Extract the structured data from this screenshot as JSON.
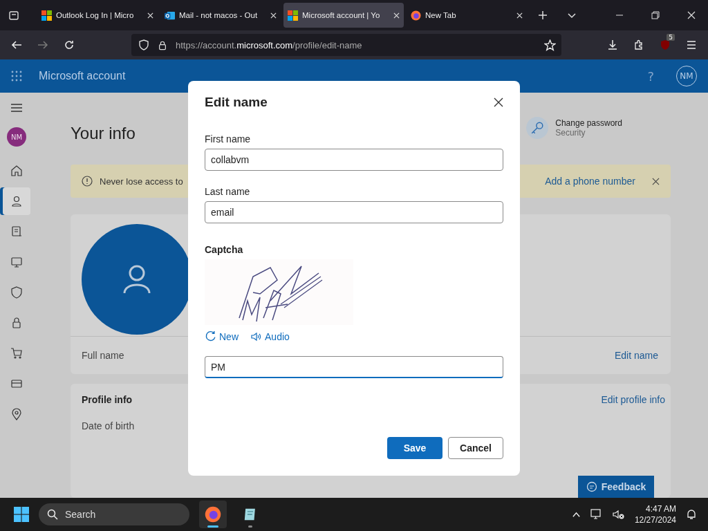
{
  "browser": {
    "tabs": [
      {
        "kind": "microsoft",
        "title": "Outlook Log In | Micro",
        "selected": false
      },
      {
        "kind": "outlook",
        "title": "Mail - not macos - Out",
        "selected": false
      },
      {
        "kind": "microsoft",
        "title": "Microsoft account | Yo",
        "selected": true
      },
      {
        "kind": "firefox",
        "title": "New Tab",
        "selected": false
      }
    ],
    "url": "https://account.**microsoft.com**/profile/edit-name",
    "extension_badge": "5"
  },
  "header": {
    "title": "Microsoft account",
    "help": "?",
    "avatar": "NM"
  },
  "sidebar": {
    "avatar": "NM",
    "items": [
      {
        "kind": "home",
        "selected": false
      },
      {
        "kind": "profile",
        "selected": true
      },
      {
        "kind": "subscriptions",
        "selected": false
      },
      {
        "kind": "devices",
        "selected": false
      },
      {
        "kind": "security",
        "selected": false
      },
      {
        "kind": "privacy",
        "selected": false
      },
      {
        "kind": "cart",
        "selected": false
      },
      {
        "kind": "card",
        "selected": false
      },
      {
        "kind": "location",
        "selected": false
      }
    ]
  },
  "content": {
    "title": "Your info",
    "quick_link": {
      "title": "Change password",
      "subtitle": "Security"
    },
    "banner": {
      "text": "Never lose access to",
      "link": "Add a phone number"
    },
    "name_card": {
      "label": "Full name",
      "link": "Edit name"
    },
    "profile_info": {
      "title": "Profile info",
      "link": "Edit profile info",
      "row_label": "Date of birth"
    },
    "feedback": "Feedback"
  },
  "dialog": {
    "title": "Edit name",
    "fields": [
      {
        "label": "First name",
        "value": "collabvm",
        "focused": false
      },
      {
        "label": "Last name",
        "value": "email",
        "focused": false
      }
    ],
    "captcha": {
      "label": "Captcha",
      "new": "New",
      "audio": "Audio",
      "value": "PM",
      "focused": true
    },
    "buttons": [
      {
        "kind": "primary",
        "label": "Save"
      },
      {
        "kind": "secondary",
        "label": "Cancel"
      }
    ]
  },
  "taskbar": {
    "search": "Search",
    "apps": [
      {
        "kind": "firefox",
        "selected": true
      },
      {
        "kind": "notepad",
        "selected": false
      }
    ],
    "time": "4:47 AM",
    "date": "12/27/2024"
  }
}
